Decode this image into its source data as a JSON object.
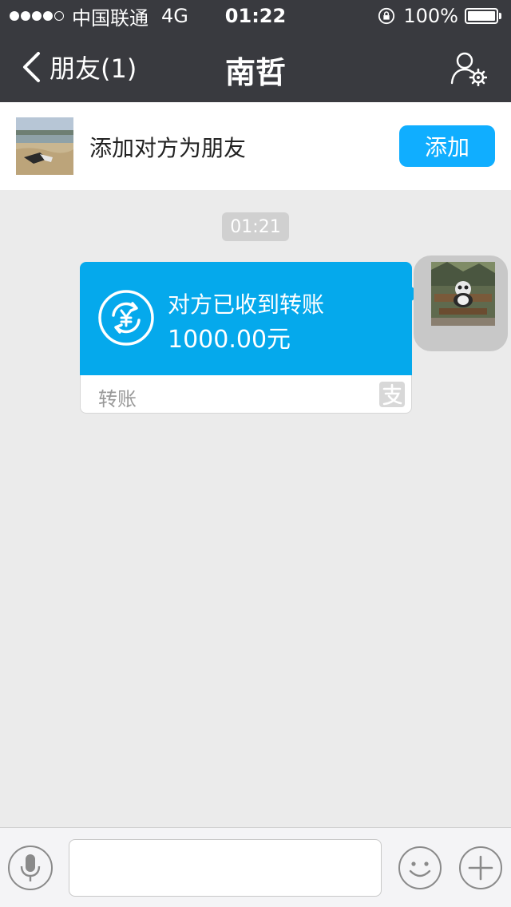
{
  "status_bar": {
    "signal_dots": 4,
    "carrier": "中国联通",
    "network": "4G",
    "time": "01:22",
    "battery": "100%"
  },
  "nav": {
    "back_label": "朋友(1)",
    "title": "南哲",
    "settings_icon": "profile-settings-icon"
  },
  "banner": {
    "text": "添加对方为朋友",
    "add_label": "添加"
  },
  "chat": {
    "timestamp": "01:21",
    "transfer": {
      "status": "对方已收到转账",
      "amount": "1000.00元",
      "label": "转账",
      "accent": "#05a9ec"
    }
  },
  "input_bar": {
    "placeholder": "",
    "voice_icon": "microphone-icon",
    "emoji_icon": "smiley-icon",
    "plus_icon": "plus-icon"
  },
  "colors": {
    "bar_bg": "#393a3f",
    "add_button": "#10aeff",
    "chat_bg": "#ebebeb"
  }
}
